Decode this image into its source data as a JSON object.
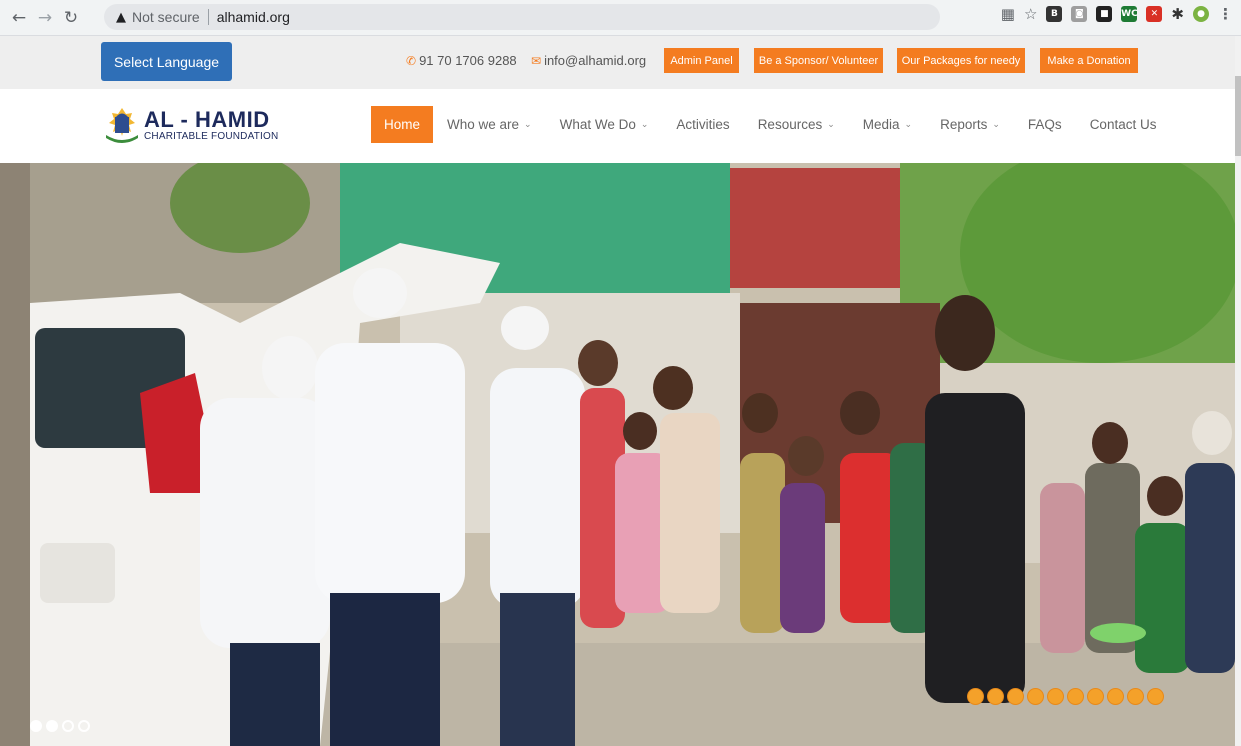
{
  "browser": {
    "security_label": "Not secure",
    "url": "alhamid.org",
    "extensions": [
      "qr-icon",
      "star-icon",
      "bookmark-icon",
      "ext-gray-icon",
      "ext-dark-icon",
      "wc-icon",
      "pdf-icon",
      "puzzle-icon",
      "avatar-icon",
      "menu-icon"
    ],
    "wc_label": "WC"
  },
  "topbar": {
    "language_button": "Select Language",
    "phone": "91 70 1706 9288",
    "email": "info@alhamid.org",
    "buttons": {
      "admin": "Admin Panel",
      "sponsor": "Be a Sponsor/ Volunteer",
      "packages": "Our Packages for needy",
      "donate": "Make a Donation"
    },
    "accent_color": "#f47c20",
    "language_color": "#2f6fb7"
  },
  "logo": {
    "title": "AL - HAMID",
    "subtitle": "CHARITABLE FOUNDATION"
  },
  "nav": {
    "items": [
      {
        "label": "Home",
        "active": true,
        "dropdown": false
      },
      {
        "label": "Who we are",
        "active": false,
        "dropdown": true
      },
      {
        "label": "What We Do",
        "active": false,
        "dropdown": true
      },
      {
        "label": "Activities",
        "active": false,
        "dropdown": false
      },
      {
        "label": "Resources",
        "active": false,
        "dropdown": true
      },
      {
        "label": "Media",
        "active": false,
        "dropdown": true
      },
      {
        "label": "Reports",
        "active": false,
        "dropdown": true
      },
      {
        "label": "FAQs",
        "active": false,
        "dropdown": false
      },
      {
        "label": "Contact Us",
        "active": false,
        "dropdown": false
      }
    ]
  },
  "hero": {
    "description": "Volunteers in white caps distributing food packages from a white car to a line of children",
    "slider_dots_left": {
      "count": 4,
      "active_index": 0
    },
    "slider_dots_right": {
      "count": 10
    }
  }
}
